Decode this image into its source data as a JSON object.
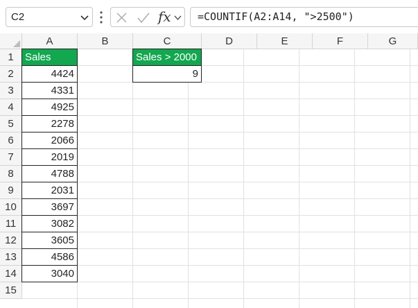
{
  "formula_bar": {
    "name_box": "C2",
    "fx_label": "fx",
    "formula": "=COUNTIF(A2:A14, \">2500\")"
  },
  "columns": [
    "A",
    "B",
    "C",
    "D",
    "E",
    "F",
    "G"
  ],
  "rows": [
    "1",
    "2",
    "3",
    "4",
    "5",
    "6",
    "7",
    "8",
    "9",
    "10",
    "11",
    "12",
    "13",
    "14",
    "15"
  ],
  "sheet": {
    "a1": "Sales",
    "sales": [
      "4424",
      "4331",
      "4925",
      "2278",
      "2066",
      "2019",
      "4788",
      "2031",
      "3697",
      "3082",
      "3605",
      "4586",
      "3040"
    ],
    "c1": "Sales > 2000",
    "c2": "9"
  },
  "colors": {
    "header_fill": "#13a750",
    "header_text": "#ffffff"
  }
}
